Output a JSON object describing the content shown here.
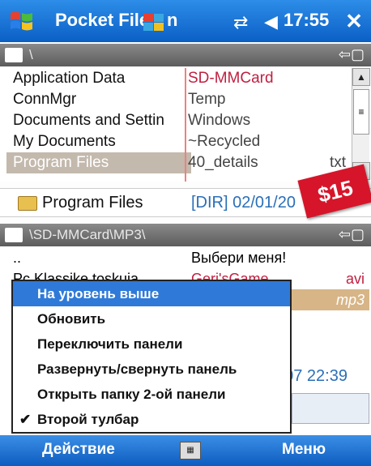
{
  "status_bar": {
    "app_title": "Pocket File",
    "title_suffix": "n",
    "clock": "17:55",
    "close_label": "✕"
  },
  "top_panel": {
    "path": "\\",
    "left_items": [
      "Application Data",
      "ConnMgr",
      "Documents and Settin",
      "My Documents",
      "Program Files"
    ],
    "selected_index": 4,
    "right_items": [
      {
        "name": "SD-MMCard",
        "ext": ""
      },
      {
        "name": "Temp",
        "ext": ""
      },
      {
        "name": "Windows",
        "ext": ""
      },
      {
        "name": "~Recycled",
        "ext": ""
      },
      {
        "name": "40_details",
        "ext": "txt"
      }
    ]
  },
  "info_line": {
    "name": "Program Files",
    "meta": "[DIR] 02/01/20"
  },
  "sticker": {
    "label": "$15",
    "color": "#d6152a"
  },
  "bottom_panel": {
    "path": "\\SD-MMCard\\MP3\\",
    "left_items": [
      "..",
      "Pc Klassike toskuja"
    ],
    "right_items": [
      {
        "name": "Выбери меня!",
        "ext": ""
      },
      {
        "name": "Geri'sGame",
        "ext": "avi"
      },
      {
        "name": "",
        "ext": "mp3"
      }
    ],
    "date": "007 22:39"
  },
  "context_menu": {
    "items": [
      {
        "label": "На уровень выше",
        "highlighted": true,
        "checked": false
      },
      {
        "label": "Обновить",
        "highlighted": false,
        "checked": false
      },
      {
        "label": "Переключить панели",
        "highlighted": false,
        "checked": false
      },
      {
        "label": "Развернуть/свернуть панель",
        "highlighted": false,
        "checked": false
      },
      {
        "label": "Открыть папку 2-ой панели",
        "highlighted": false,
        "checked": false
      },
      {
        "label": "Второй тулбар",
        "highlighted": false,
        "checked": true
      }
    ],
    "check_glyph": "✔"
  },
  "softkeys": {
    "left": "Действие",
    "right": "Меню"
  },
  "colors": {
    "accent": "#0b5fc6",
    "highlight": "#2f7ad8",
    "selected_row": "#c3b9ad",
    "drive_text": "#c02040"
  }
}
